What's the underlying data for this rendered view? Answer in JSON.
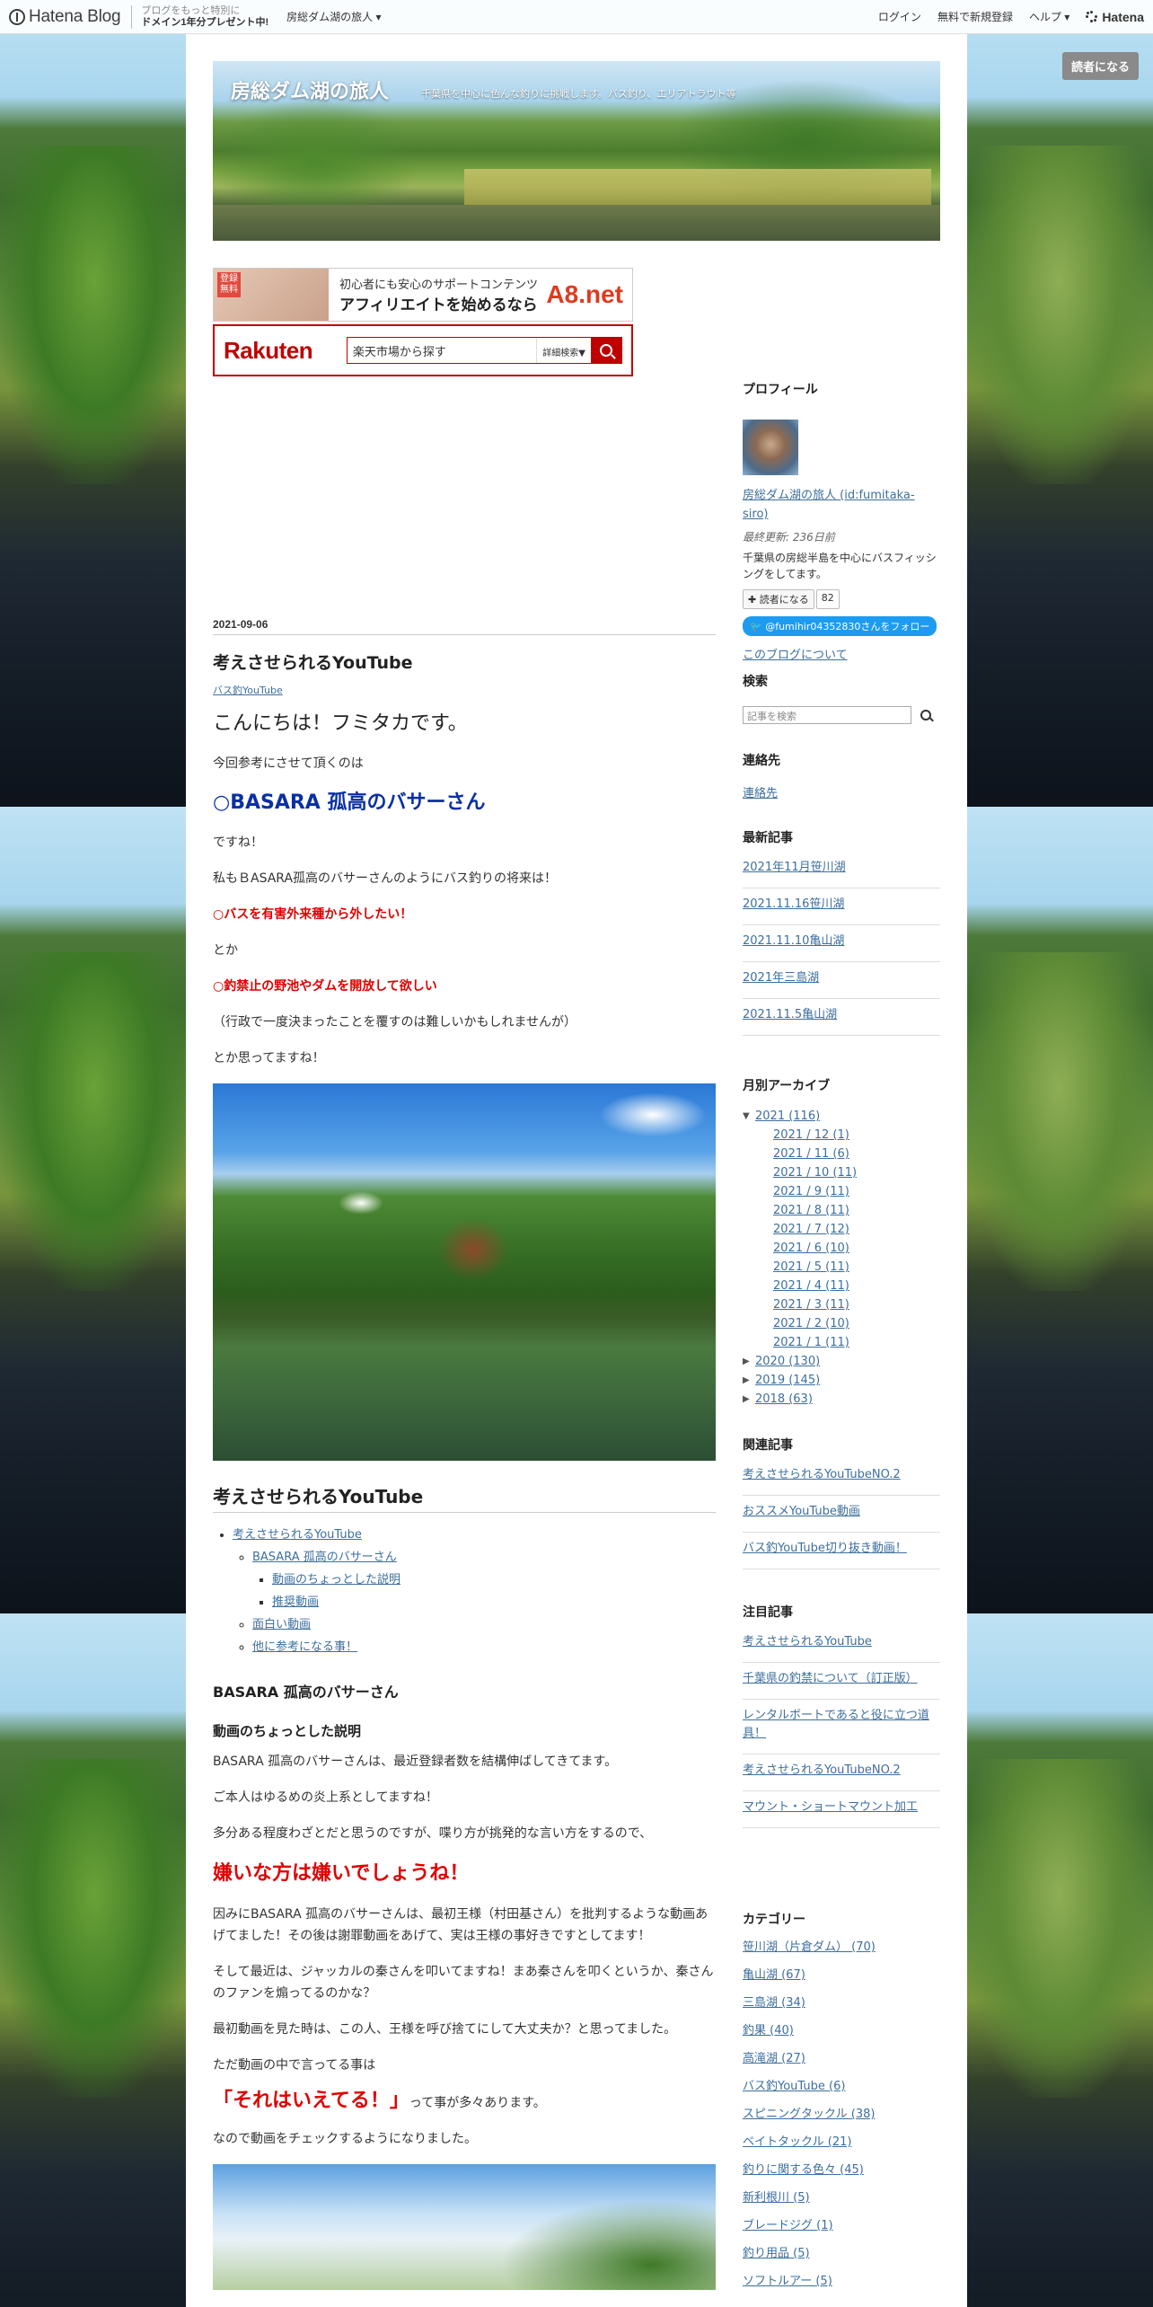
{
  "global_header": {
    "logo_text": "Hatena Blog",
    "promo_line1": "ブログをもっと特別に",
    "promo_line2": "ドメイン1年分プレゼント中!",
    "blog_menu": "房総ダム湖の旅人 ▾",
    "login": "ログイン",
    "signup": "無料で新規登録",
    "help": "ヘルプ ▾",
    "brand": "Hatena"
  },
  "subscribe_button": "読者になる",
  "blog": {
    "title": "房総ダム湖の旅人",
    "description": "千葉県を中心に色んな釣りに挑戦します。バス釣り、エリアトラウト等"
  },
  "ads": {
    "a8": {
      "tag": "登録 無料",
      "line1": "初心者にも安心のサポートコンテンツ",
      "line2": "アフィリエイトを始めるなら",
      "logo": "A8.net"
    },
    "rakuten": {
      "logo": "Rakuten",
      "placeholder": "楽天市場から探す",
      "detail": "詳細検索▼"
    }
  },
  "entry": {
    "date": "2021-09-06",
    "title": "考えさせられるYouTube",
    "category": "バス釣YouTube",
    "p1": "こんにちは！フミタカです。",
    "p2": "今回参考にさせて頂くのは",
    "p3": "○BASARA 孤高のバサーさん",
    "p4": "ですね！",
    "p5": "私もＢASARA孤高のバサーさんのようにバス釣りの将来は！",
    "p6": "○バスを有害外来種から外したい！",
    "p7": "とか",
    "p8": "○釣禁止の野池やダムを開放して欲しい",
    "p9": "（行政で一度決まったことを覆すのは難しいかもしれませんが）",
    "p10": "とか思ってますね！",
    "toc_heading": "考えさせられるYouTube",
    "toc": {
      "item1": "考えさせられるYouTube",
      "item1_1": "BASARA 孤高のバサーさん",
      "item1_1_1": "動画のちょっとした説明",
      "item1_1_2": "推奨動画",
      "item1_2": "面白い動画",
      "item1_3": "他に参考になる事！"
    },
    "h4": "BASARA 孤高のバサーさん",
    "h5": "動画のちょっとした説明",
    "q1": "BASARA 孤高のバサーさんは、最近登録者数を結構伸ばしてきてます。",
    "q2": "ご本人はゆるめの炎上系としてますね！",
    "q3": "多分ある程度わざとだと思うのですが、喋り方が挑発的な言い方をするので、",
    "q4": "嫌いな方は嫌いでしょうね！",
    "q5": "因みにBASARA 孤高のバサーさんは、最初王様（村田基さん）を批判するような動画あげてました！その後は謝罪動画をあげて、実は王様の事好きですとしてます！",
    "q6": "そして最近は、ジャッカルの秦さんを叩いてますね！まあ秦さんを叩くというか、秦さんのファンを煽ってるのかな？",
    "q7": "最初動画を見た時は、この人、王様を呼び捨てにして大丈夫か？と思ってました。",
    "q8": "ただ動画の中で言ってる事は",
    "q9_red": "「それはいえてる！」",
    "q9_rest": "って事が多々あります。",
    "q10": "なので動画をチェックするようになりました。"
  },
  "sidebar": {
    "profile": {
      "heading": "プロフィール",
      "name": "房総ダム湖の旅人 (id:fumitaka-siro)",
      "updated": "最終更新: 236日前",
      "desc": "千葉県の房総半島を中心にバスフィッシングをしてます。",
      "subscribe": "✚ 読者になる",
      "count": "82",
      "twitter": "@fumihir04352830さんをフォロー",
      "about": "このブログについて"
    },
    "search": {
      "heading": "検索",
      "placeholder": "記事を検索"
    },
    "contact": {
      "heading": "連絡先",
      "link": "連絡先"
    },
    "recent": {
      "heading": "最新記事",
      "items": [
        "2021年11月笹川湖",
        "2021.11.16笹川湖",
        "2021.11.10亀山湖",
        "2021年三島湖",
        "2021.11.5亀山湖"
      ]
    },
    "archive": {
      "heading": "月別アーカイブ",
      "y2021": "2021 (116)",
      "months": [
        "2021 / 12 (1)",
        "2021 / 11 (6)",
        "2021 / 10 (11)",
        "2021 / 9 (11)",
        "2021 / 8 (11)",
        "2021 / 7 (12)",
        "2021 / 6 (10)",
        "2021 / 5 (11)",
        "2021 / 4 (11)",
        "2021 / 3 (11)",
        "2021 / 2 (10)",
        "2021 / 1 (11)"
      ],
      "y2020": "2020 (130)",
      "y2019": "2019 (145)",
      "y2018": "2018 (63)"
    },
    "related": {
      "heading": "関連記事",
      "items": [
        "考えさせられるYouTubeNO.2",
        "おススメYouTube動画",
        "バス釣YouTube切り抜き動画！"
      ]
    },
    "featured": {
      "heading": "注目記事",
      "items": [
        "考えさせられるYouTube",
        "千葉県の釣禁について（訂正版）",
        "レンタルボートであると役に立つ道具！",
        "考えさせられるYouTubeNO.2",
        "マウント・ショートマウント加工"
      ]
    },
    "categories": {
      "heading": "カテゴリー",
      "items": [
        "笹川湖（片倉ダム） (70)",
        "亀山湖 (67)",
        "三島湖 (34)",
        "釣果 (40)",
        "高滝湖 (27)",
        "バス釣YouTube (6)",
        "スピニングタックル (38)",
        "ベイトタックル (21)",
        "釣りに関する色々 (45)",
        "新利根川 (5)",
        "ブレードジグ (1)",
        "釣り用品 (5)",
        "ソフトルアー (5)"
      ]
    }
  }
}
